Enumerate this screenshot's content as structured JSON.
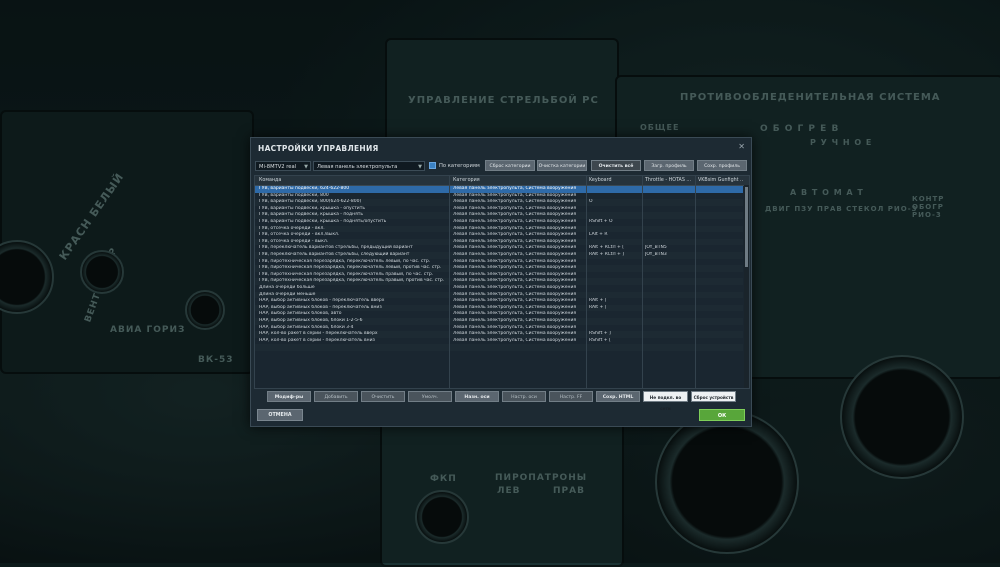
{
  "background": {
    "labels": {
      "fire_control": "УПРАВЛЕНИЕ СТРЕЛЬБОЙ РС",
      "anti_ice": "ПРОТИВООБЛЕДЕНИТЕЛЬНАЯ СИСТЕМА",
      "common": "ОБЩЕЕ",
      "heating": "О Б О Г Р Е В",
      "manual": "Р У Ч Н О Е",
      "auto": "А В Т О М А Т",
      "left_switches": "КРАСН  БЕЛЫЙ",
      "vent": "ВЕНТИЛЯТОР",
      "avia_horiz": "АВИА ГОРИЗ",
      "vk53": "ВК-53",
      "pyro": "ПИРОПАТРОНЫ",
      "pyro_left": "ЛЕВ",
      "pyro_right": "ПРАВ",
      "engine_rio": "ДВИГ ПЗУ ПРАВ  СТЕКОЛ  РИО-3",
      "contr": "КОНТР ОБОГР РИО-3",
      "fkp": "ФКП"
    }
  },
  "dialog": {
    "title": "НАСТРОЙКИ УПРАВЛЕНИЯ",
    "close_icon": "close-icon",
    "aircraft_select": "Mi-8MTV2 real",
    "category_select": "Левая панель электропульта",
    "by_categories_label": "По категориям",
    "by_categories_checked": true,
    "top_buttons": [
      "Сброс категории",
      "Очистка категории",
      "Очистить всё",
      "Загр. профиль",
      "Сохр. профиль"
    ],
    "columns": [
      "Команда",
      "Категория",
      "Keyboard",
      "Throttle - HOTAS ...",
      "VKBsim Gunfight ..."
    ],
    "rows": [
      {
        "cmd": "ГУВ, варианты подвески, 624-622-800",
        "cat": "Левая панель электропульта, Система вооружения",
        "kb": "",
        "thr": ""
      },
      {
        "cmd": "ГУВ, варианты подвески, 800",
        "cat": "Левая панель электропульта, Система вооружения",
        "kb": "",
        "thr": ""
      },
      {
        "cmd": "ГУВ, варианты подвески, 800(624-622-800)",
        "cat": "Левая панель электропульта, Система вооружения",
        "kb": "O",
        "thr": ""
      },
      {
        "cmd": "ГУВ, варианты подвески, крышка - опустить",
        "cat": "Левая панель электропульта, Система вооружения",
        "kb": "",
        "thr": ""
      },
      {
        "cmd": "ГУВ, варианты подвески, крышка - поднять",
        "cat": "Левая панель электропульта, Система вооружения",
        "kb": "",
        "thr": ""
      },
      {
        "cmd": "ГУВ, варианты подвески, крышка - поднять/опустить",
        "cat": "Левая панель электропульта, Система вооружения",
        "kb": "RShift + O",
        "thr": ""
      },
      {
        "cmd": "ГУВ, отсечка очереди - вкл.",
        "cat": "Левая панель электропульта, Система вооружения",
        "kb": "",
        "thr": ""
      },
      {
        "cmd": "ГУВ, отсечка очереди - вкл./выкл.",
        "cat": "Левая панель электропульта, Система вооружения",
        "kb": "LAlt + R",
        "thr": ""
      },
      {
        "cmd": "ГУВ, отсечка очереди - выкл.",
        "cat": "Левая панель электропульта, Система вооружения",
        "kb": "",
        "thr": ""
      },
      {
        "cmd": "ГУВ, переключатель вариантов стрельбы, предыдущий вариант",
        "cat": "Левая панель электропульта, Система вооружения",
        "kb": "RAlt + RCtrl + [",
        "thr": "JOY_BTN5"
      },
      {
        "cmd": "ГУВ, переключатель вариантов стрельбы, следующий вариант",
        "cat": "Левая панель электропульта, Система вооружения",
        "kb": "RAlt + RCtrl + ]",
        "thr": "JOY_BTN3"
      },
      {
        "cmd": "ГУВ, пиротехническая перезарядка, переключатель левый, по час. стр.",
        "cat": "Левая панель электропульта, Система вооружения",
        "kb": "",
        "thr": ""
      },
      {
        "cmd": "ГУВ, пиротехническая перезарядка, переключатель левый, против час. стр.",
        "cat": "Левая панель электропульта, Система вооружения",
        "kb": "",
        "thr": ""
      },
      {
        "cmd": "ГУВ, пиротехническая перезарядка, переключатель правый, по час. стр.",
        "cat": "Левая панель электропульта, Система вооружения",
        "kb": "",
        "thr": ""
      },
      {
        "cmd": "ГУВ, пиротехническая перезарядка, переключатель правый, против час. стр.",
        "cat": "Левая панель электропульта, Система вооружения",
        "kb": "",
        "thr": ""
      },
      {
        "cmd": "Длина очереди больше",
        "cat": "Левая панель электропульта, Система вооружения",
        "kb": "",
        "thr": ""
      },
      {
        "cmd": "Длина очереди меньше",
        "cat": "Левая панель электропульта, Система вооружения",
        "kb": "",
        "thr": ""
      },
      {
        "cmd": "НАР, выбор активных блоков - переключатель вверх",
        "cat": "Левая панель электропульта, Система вооружения",
        "kb": "RAlt + ]",
        "thr": ""
      },
      {
        "cmd": "НАР, выбор активных блоков - переключатель вниз",
        "cat": "Левая панель электропульта, Система вооружения",
        "kb": "RAlt + [",
        "thr": ""
      },
      {
        "cmd": "НАР, выбор активных блоков, авто",
        "cat": "Левая панель электропульта, Система вооружения",
        "kb": "",
        "thr": ""
      },
      {
        "cmd": "НАР, выбор активных блоков, блоки 1-2-5-6",
        "cat": "Левая панель электропульта, Система вооружения",
        "kb": "",
        "thr": ""
      },
      {
        "cmd": "НАР, выбор активных блоков, блоки 3-4",
        "cat": "Левая панель электропульта, Система вооружения",
        "kb": "",
        "thr": ""
      },
      {
        "cmd": "НАР, кол-во ракет в серии - переключатель вверх",
        "cat": "Левая панель электропульта, Система вооружения",
        "kb": "RShift + ]",
        "thr": ""
      },
      {
        "cmd": "НАР, кол-во ракет в серии - переключатель вниз",
        "cat": "Левая панель электропульта, Система вооружения",
        "kb": "RShift + [",
        "thr": ""
      },
      {
        "cmd": "",
        "cat": "",
        "kb": "",
        "thr": ""
      }
    ],
    "bottom_buttons": [
      "Модиф-ры",
      "Добавить",
      "Очистить",
      "Умолч.",
      "Назн. оси",
      "Настр. оси",
      "Настр. FF",
      "Сохр. HTML",
      "Не подкл. во сети",
      "Сброс устройств"
    ],
    "cancel_label": "ОТМЕНА",
    "ok_label": "ОК"
  }
}
